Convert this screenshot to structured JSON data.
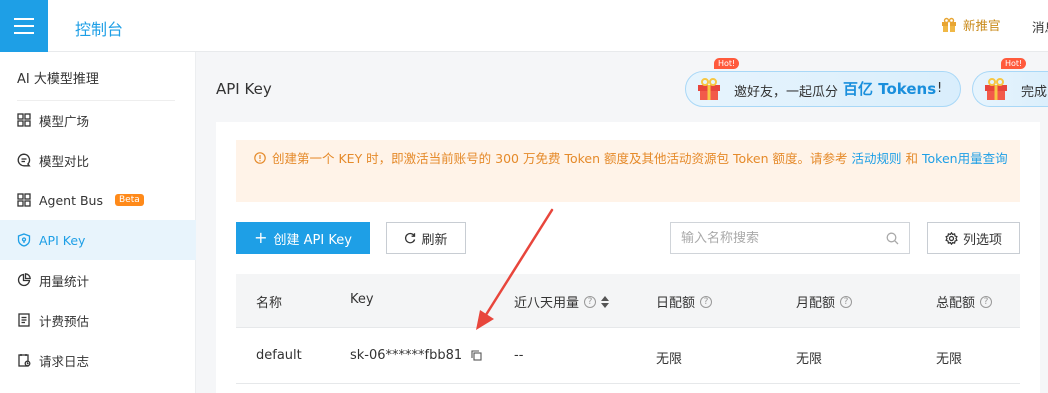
{
  "topbar": {
    "title": "控制台",
    "promo_label": "新推官",
    "messages_label": "消息"
  },
  "sidebar": {
    "section_title": "AI 大模型推理",
    "items": [
      {
        "label": "模型广场",
        "icon": "grid-icon"
      },
      {
        "label": "模型对比",
        "icon": "chat-icon"
      },
      {
        "label": "Agent Bus",
        "icon": "grid-icon",
        "badge": "Beta"
      },
      {
        "label": "API Key",
        "icon": "shield-icon",
        "active": true
      },
      {
        "label": "用量统计",
        "icon": "pie-chart-icon"
      },
      {
        "label": "计费预估",
        "icon": "document-icon"
      },
      {
        "label": "请求日志",
        "icon": "log-icon"
      }
    ]
  },
  "page": {
    "title": "API Key"
  },
  "banners": [
    {
      "hot": "Hot!",
      "prefix": "邀好友，一起瓜分",
      "highlight": "百亿 Tokens",
      "suffix": "!"
    },
    {
      "hot": "Hot!",
      "prefix": "完成"
    }
  ],
  "notice": {
    "text": "创建第一个 KEY 时，即激活当前账号的 300 万免费 Token 额度及其他活动资源包 Token 额度。请参考",
    "link1": "活动规则",
    "and": "和",
    "link2": "Token用量查询"
  },
  "toolbar": {
    "create_label": "创建 API Key",
    "refresh_label": "刷新",
    "search_placeholder": "输入名称搜索",
    "columns_label": "列选项"
  },
  "table": {
    "headers": [
      "名称",
      "Key",
      "近八天用量",
      "日配额",
      "月配额",
      "总配额"
    ],
    "rows": [
      {
        "name": "default",
        "key": "sk-06******fbb81",
        "usage": "--",
        "daily": "无限",
        "monthly": "无限",
        "total": "无限"
      }
    ]
  },
  "colors": {
    "accent": "#1e9fe6",
    "notice_bg": "#fff3e8",
    "notice_text": "#e58a2a",
    "arrow": "#e8463c"
  }
}
